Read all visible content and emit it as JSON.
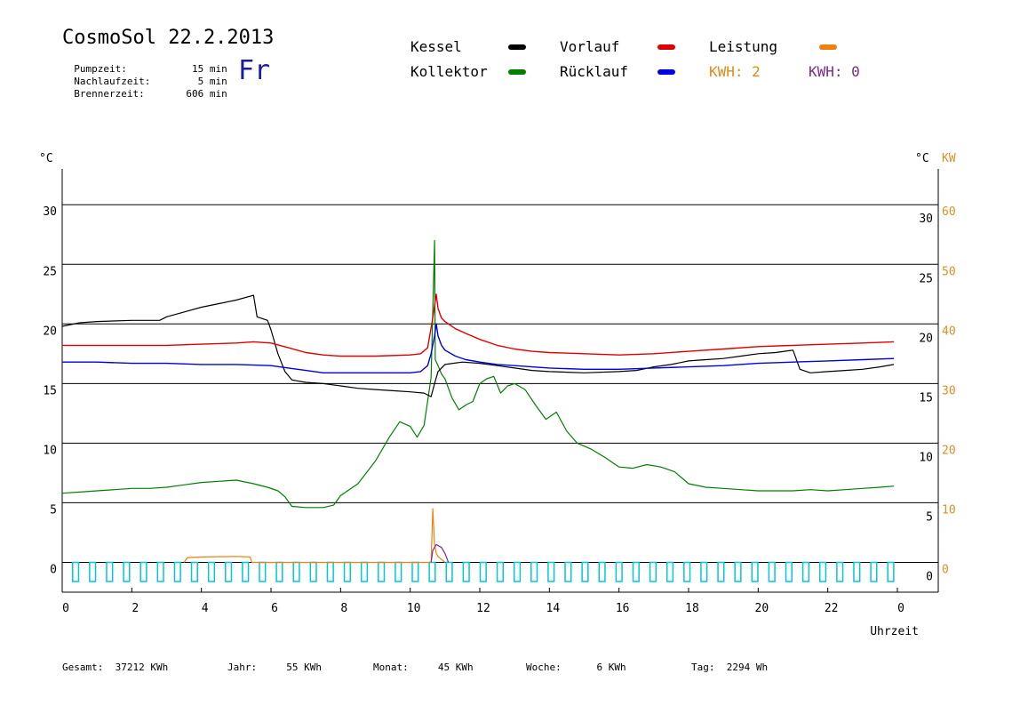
{
  "header": {
    "title": "CosmoSol 22.2.2013",
    "day": "Fr",
    "info": [
      {
        "label": "Pumpzeit:",
        "value": "15",
        "unit": "min"
      },
      {
        "label": "Nachlaufzeit:",
        "value": "5",
        "unit": "min"
      },
      {
        "label": "Brennerzeit:",
        "value": "606",
        "unit": "min"
      }
    ]
  },
  "legend": {
    "kessel": {
      "label": "Kessel",
      "color": "#000000"
    },
    "vorlauf": {
      "label": "Vorlauf",
      "color": "#e00000"
    },
    "leistung": {
      "label": "Leistung",
      "color": "#f08010"
    },
    "kollektor": {
      "label": "Kollektor",
      "color": "#008000"
    },
    "ruecklauf": {
      "label": "Rücklauf",
      "color": "#0000e0"
    },
    "kwh1": {
      "label": "KWH: 2",
      "color": "#e08a1a"
    },
    "kwh2": {
      "label": "KWH: 0",
      "color": "#7a2a8a"
    }
  },
  "footer": [
    {
      "label": "Gesamt:",
      "value": "37212 KWh"
    },
    {
      "label": "Jahr:",
      "value": "55 KWh"
    },
    {
      "label": "Monat:",
      "value": "45 KWh"
    },
    {
      "label": "Woche:",
      "value": "6 KWh"
    },
    {
      "label": "Tag:",
      "value": "2294 Wh"
    }
  ],
  "chart_data": {
    "type": "line",
    "xlabel": "Uhrzeit",
    "ylabel_left": "°C",
    "ylabel_right": "°C",
    "ylabel_power": "KW",
    "xlim": [
      0,
      24
    ],
    "ylim": [
      -2.5,
      33
    ],
    "ylim_power": [
      -5,
      66
    ],
    "x_ticks": [
      0,
      2,
      4,
      6,
      8,
      10,
      12,
      14,
      16,
      18,
      20,
      22,
      24
    ],
    "x_tick_labels": [
      "0",
      "2",
      "4",
      "6",
      "8",
      "10",
      "12",
      "14",
      "16",
      "18",
      "20",
      "22",
      "0"
    ],
    "y_ticks": [
      0,
      5,
      10,
      15,
      20,
      25,
      30
    ],
    "y_tick_labels": [
      "0",
      "5",
      "10",
      "15",
      "20",
      "25",
      "30"
    ],
    "power_ticks": [
      0,
      10,
      20,
      30,
      40,
      50,
      60
    ],
    "power_tick_labels": [
      "0",
      "10",
      "20",
      "30",
      "40",
      "50",
      "60"
    ],
    "grid": "horizontal",
    "series": [
      {
        "key": "kollektor",
        "color": "#008000",
        "points": [
          [
            0,
            5.8
          ],
          [
            0.5,
            5.9
          ],
          [
            1,
            6.0
          ],
          [
            1.5,
            6.1
          ],
          [
            2,
            6.2
          ],
          [
            2.5,
            6.2
          ],
          [
            3,
            6.3
          ],
          [
            3.5,
            6.5
          ],
          [
            4,
            6.7
          ],
          [
            4.5,
            6.8
          ],
          [
            5,
            6.9
          ],
          [
            5.5,
            6.6
          ],
          [
            5.9,
            6.3
          ],
          [
            6.2,
            6.0
          ],
          [
            6.4,
            5.5
          ],
          [
            6.6,
            4.7
          ],
          [
            7,
            4.6
          ],
          [
            7.5,
            4.6
          ],
          [
            7.8,
            4.8
          ],
          [
            8,
            5.6
          ],
          [
            8.5,
            6.6
          ],
          [
            9,
            8.5
          ],
          [
            9.4,
            10.5
          ],
          [
            9.7,
            11.8
          ],
          [
            10,
            11.4
          ],
          [
            10.2,
            10.5
          ],
          [
            10.4,
            11.5
          ],
          [
            10.6,
            15.5
          ],
          [
            10.7,
            27.0
          ],
          [
            10.72,
            17.0
          ],
          [
            10.8,
            16.5
          ],
          [
            10.9,
            15.8
          ],
          [
            11,
            15.4
          ],
          [
            11.2,
            13.8
          ],
          [
            11.4,
            12.8
          ],
          [
            11.6,
            13.2
          ],
          [
            11.8,
            13.5
          ],
          [
            12,
            15.0
          ],
          [
            12.2,
            15.4
          ],
          [
            12.4,
            15.6
          ],
          [
            12.6,
            14.2
          ],
          [
            12.8,
            14.8
          ],
          [
            13,
            15.0
          ],
          [
            13.3,
            14.5
          ],
          [
            13.6,
            13.2
          ],
          [
            13.9,
            12.0
          ],
          [
            14.2,
            12.6
          ],
          [
            14.5,
            11.0
          ],
          [
            14.8,
            10.0
          ],
          [
            15.2,
            9.5
          ],
          [
            15.6,
            8.8
          ],
          [
            16,
            8.0
          ],
          [
            16.4,
            7.9
          ],
          [
            16.8,
            8.2
          ],
          [
            17.2,
            8.0
          ],
          [
            17.6,
            7.6
          ],
          [
            18,
            6.6
          ],
          [
            18.5,
            6.3
          ],
          [
            19,
            6.2
          ],
          [
            19.5,
            6.1
          ],
          [
            20,
            6.0
          ],
          [
            20.5,
            6.0
          ],
          [
            21,
            6.0
          ],
          [
            21.5,
            6.1
          ],
          [
            22,
            6.0
          ],
          [
            22.5,
            6.1
          ],
          [
            23,
            6.2
          ],
          [
            23.5,
            6.3
          ],
          [
            23.9,
            6.4
          ]
        ]
      },
      {
        "key": "kessel",
        "color": "#000000",
        "points": [
          [
            0,
            19.8
          ],
          [
            0.5,
            20.1
          ],
          [
            1,
            20.2
          ],
          [
            2,
            20.3
          ],
          [
            2.8,
            20.3
          ],
          [
            3,
            20.6
          ],
          [
            3.5,
            21.0
          ],
          [
            4,
            21.4
          ],
          [
            4.5,
            21.7
          ],
          [
            5,
            22.0
          ],
          [
            5.5,
            22.4
          ],
          [
            5.6,
            20.6
          ],
          [
            5.9,
            20.3
          ],
          [
            6,
            19.5
          ],
          [
            6.2,
            17.5
          ],
          [
            6.4,
            16.0
          ],
          [
            6.6,
            15.3
          ],
          [
            7,
            15.1
          ],
          [
            7.5,
            15.0
          ],
          [
            8,
            14.8
          ],
          [
            8.5,
            14.6
          ],
          [
            9,
            14.5
          ],
          [
            9.5,
            14.4
          ],
          [
            10,
            14.3
          ],
          [
            10.4,
            14.2
          ],
          [
            10.6,
            13.9
          ],
          [
            10.7,
            15.0
          ],
          [
            10.8,
            16.0
          ],
          [
            11,
            16.6
          ],
          [
            11.5,
            16.8
          ],
          [
            12,
            16.7
          ],
          [
            12.5,
            16.5
          ],
          [
            13,
            16.3
          ],
          [
            13.5,
            16.1
          ],
          [
            14,
            16.0
          ],
          [
            15,
            15.9
          ],
          [
            16,
            16.0
          ],
          [
            16.5,
            16.1
          ],
          [
            17,
            16.4
          ],
          [
            17.5,
            16.6
          ],
          [
            18,
            16.9
          ],
          [
            18.5,
            17.0
          ],
          [
            19,
            17.1
          ],
          [
            19.5,
            17.3
          ],
          [
            20,
            17.5
          ],
          [
            20.5,
            17.6
          ],
          [
            21,
            17.8
          ],
          [
            21.2,
            16.2
          ],
          [
            21.5,
            15.9
          ],
          [
            22,
            16.0
          ],
          [
            22.5,
            16.1
          ],
          [
            23,
            16.2
          ],
          [
            23.5,
            16.4
          ],
          [
            23.9,
            16.6
          ]
        ]
      },
      {
        "key": "vorlauf",
        "color": "#e00000",
        "points": [
          [
            0,
            18.2
          ],
          [
            1,
            18.2
          ],
          [
            2,
            18.2
          ],
          [
            3,
            18.2
          ],
          [
            4,
            18.3
          ],
          [
            5,
            18.4
          ],
          [
            5.5,
            18.5
          ],
          [
            6,
            18.4
          ],
          [
            6.5,
            18.0
          ],
          [
            7,
            17.6
          ],
          [
            7.5,
            17.4
          ],
          [
            8,
            17.3
          ],
          [
            9,
            17.3
          ],
          [
            10,
            17.4
          ],
          [
            10.3,
            17.5
          ],
          [
            10.5,
            18.0
          ],
          [
            10.65,
            20.5
          ],
          [
            10.75,
            22.5
          ],
          [
            10.8,
            21.3
          ],
          [
            10.9,
            20.5
          ],
          [
            11,
            20.2
          ],
          [
            11.3,
            19.6
          ],
          [
            11.6,
            19.2
          ],
          [
            12,
            18.7
          ],
          [
            12.5,
            18.2
          ],
          [
            13,
            17.9
          ],
          [
            13.5,
            17.7
          ],
          [
            14,
            17.6
          ],
          [
            15,
            17.5
          ],
          [
            16,
            17.4
          ],
          [
            17,
            17.5
          ],
          [
            18,
            17.7
          ],
          [
            19,
            17.9
          ],
          [
            20,
            18.1
          ],
          [
            21,
            18.2
          ],
          [
            22,
            18.3
          ],
          [
            23,
            18.4
          ],
          [
            23.9,
            18.5
          ]
        ]
      },
      {
        "key": "ruecklauf",
        "color": "#0000e0",
        "points": [
          [
            0,
            16.8
          ],
          [
            1,
            16.8
          ],
          [
            2,
            16.7
          ],
          [
            3,
            16.7
          ],
          [
            4,
            16.6
          ],
          [
            5,
            16.6
          ],
          [
            6,
            16.5
          ],
          [
            6.5,
            16.3
          ],
          [
            7,
            16.1
          ],
          [
            7.5,
            15.9
          ],
          [
            8,
            15.9
          ],
          [
            9,
            15.9
          ],
          [
            10,
            15.9
          ],
          [
            10.3,
            16.0
          ],
          [
            10.5,
            16.5
          ],
          [
            10.6,
            17.5
          ],
          [
            10.7,
            19.0
          ],
          [
            10.75,
            20.0
          ],
          [
            10.8,
            19.0
          ],
          [
            10.9,
            18.2
          ],
          [
            11,
            17.8
          ],
          [
            11.3,
            17.3
          ],
          [
            11.6,
            17.0
          ],
          [
            12,
            16.8
          ],
          [
            12.5,
            16.6
          ],
          [
            13,
            16.5
          ],
          [
            14,
            16.3
          ],
          [
            15,
            16.2
          ],
          [
            16,
            16.2
          ],
          [
            17,
            16.3
          ],
          [
            18,
            16.4
          ],
          [
            19,
            16.5
          ],
          [
            20,
            16.7
          ],
          [
            21,
            16.8
          ],
          [
            22,
            16.9
          ],
          [
            23,
            17.0
          ],
          [
            23.9,
            17.1
          ]
        ]
      },
      {
        "key": "leistung",
        "color": "#f08010",
        "axis": "power",
        "points": [
          [
            3.5,
            0
          ],
          [
            3.6,
            0.8
          ],
          [
            4,
            0.9
          ],
          [
            5,
            1.0
          ],
          [
            5.4,
            0.9
          ],
          [
            5.45,
            0
          ],
          [
            10.6,
            0
          ],
          [
            10.65,
            9
          ],
          [
            10.7,
            3
          ],
          [
            10.75,
            1.5
          ],
          [
            10.8,
            1
          ],
          [
            10.9,
            0.5
          ],
          [
            11,
            0
          ]
        ]
      },
      {
        "key": "kwh",
        "color": "#7a2a8a",
        "axis": "power",
        "points": [
          [
            10.6,
            0
          ],
          [
            10.65,
            2
          ],
          [
            10.75,
            3
          ],
          [
            10.9,
            2.5
          ],
          [
            11,
            1.5
          ],
          [
            11.1,
            0
          ]
        ]
      }
    ],
    "pump_bars": {
      "color": "#00c8d8",
      "start": 0.3,
      "spacing": 0.488,
      "count": 49,
      "y_low": -1.6,
      "y_high": 0
    }
  }
}
